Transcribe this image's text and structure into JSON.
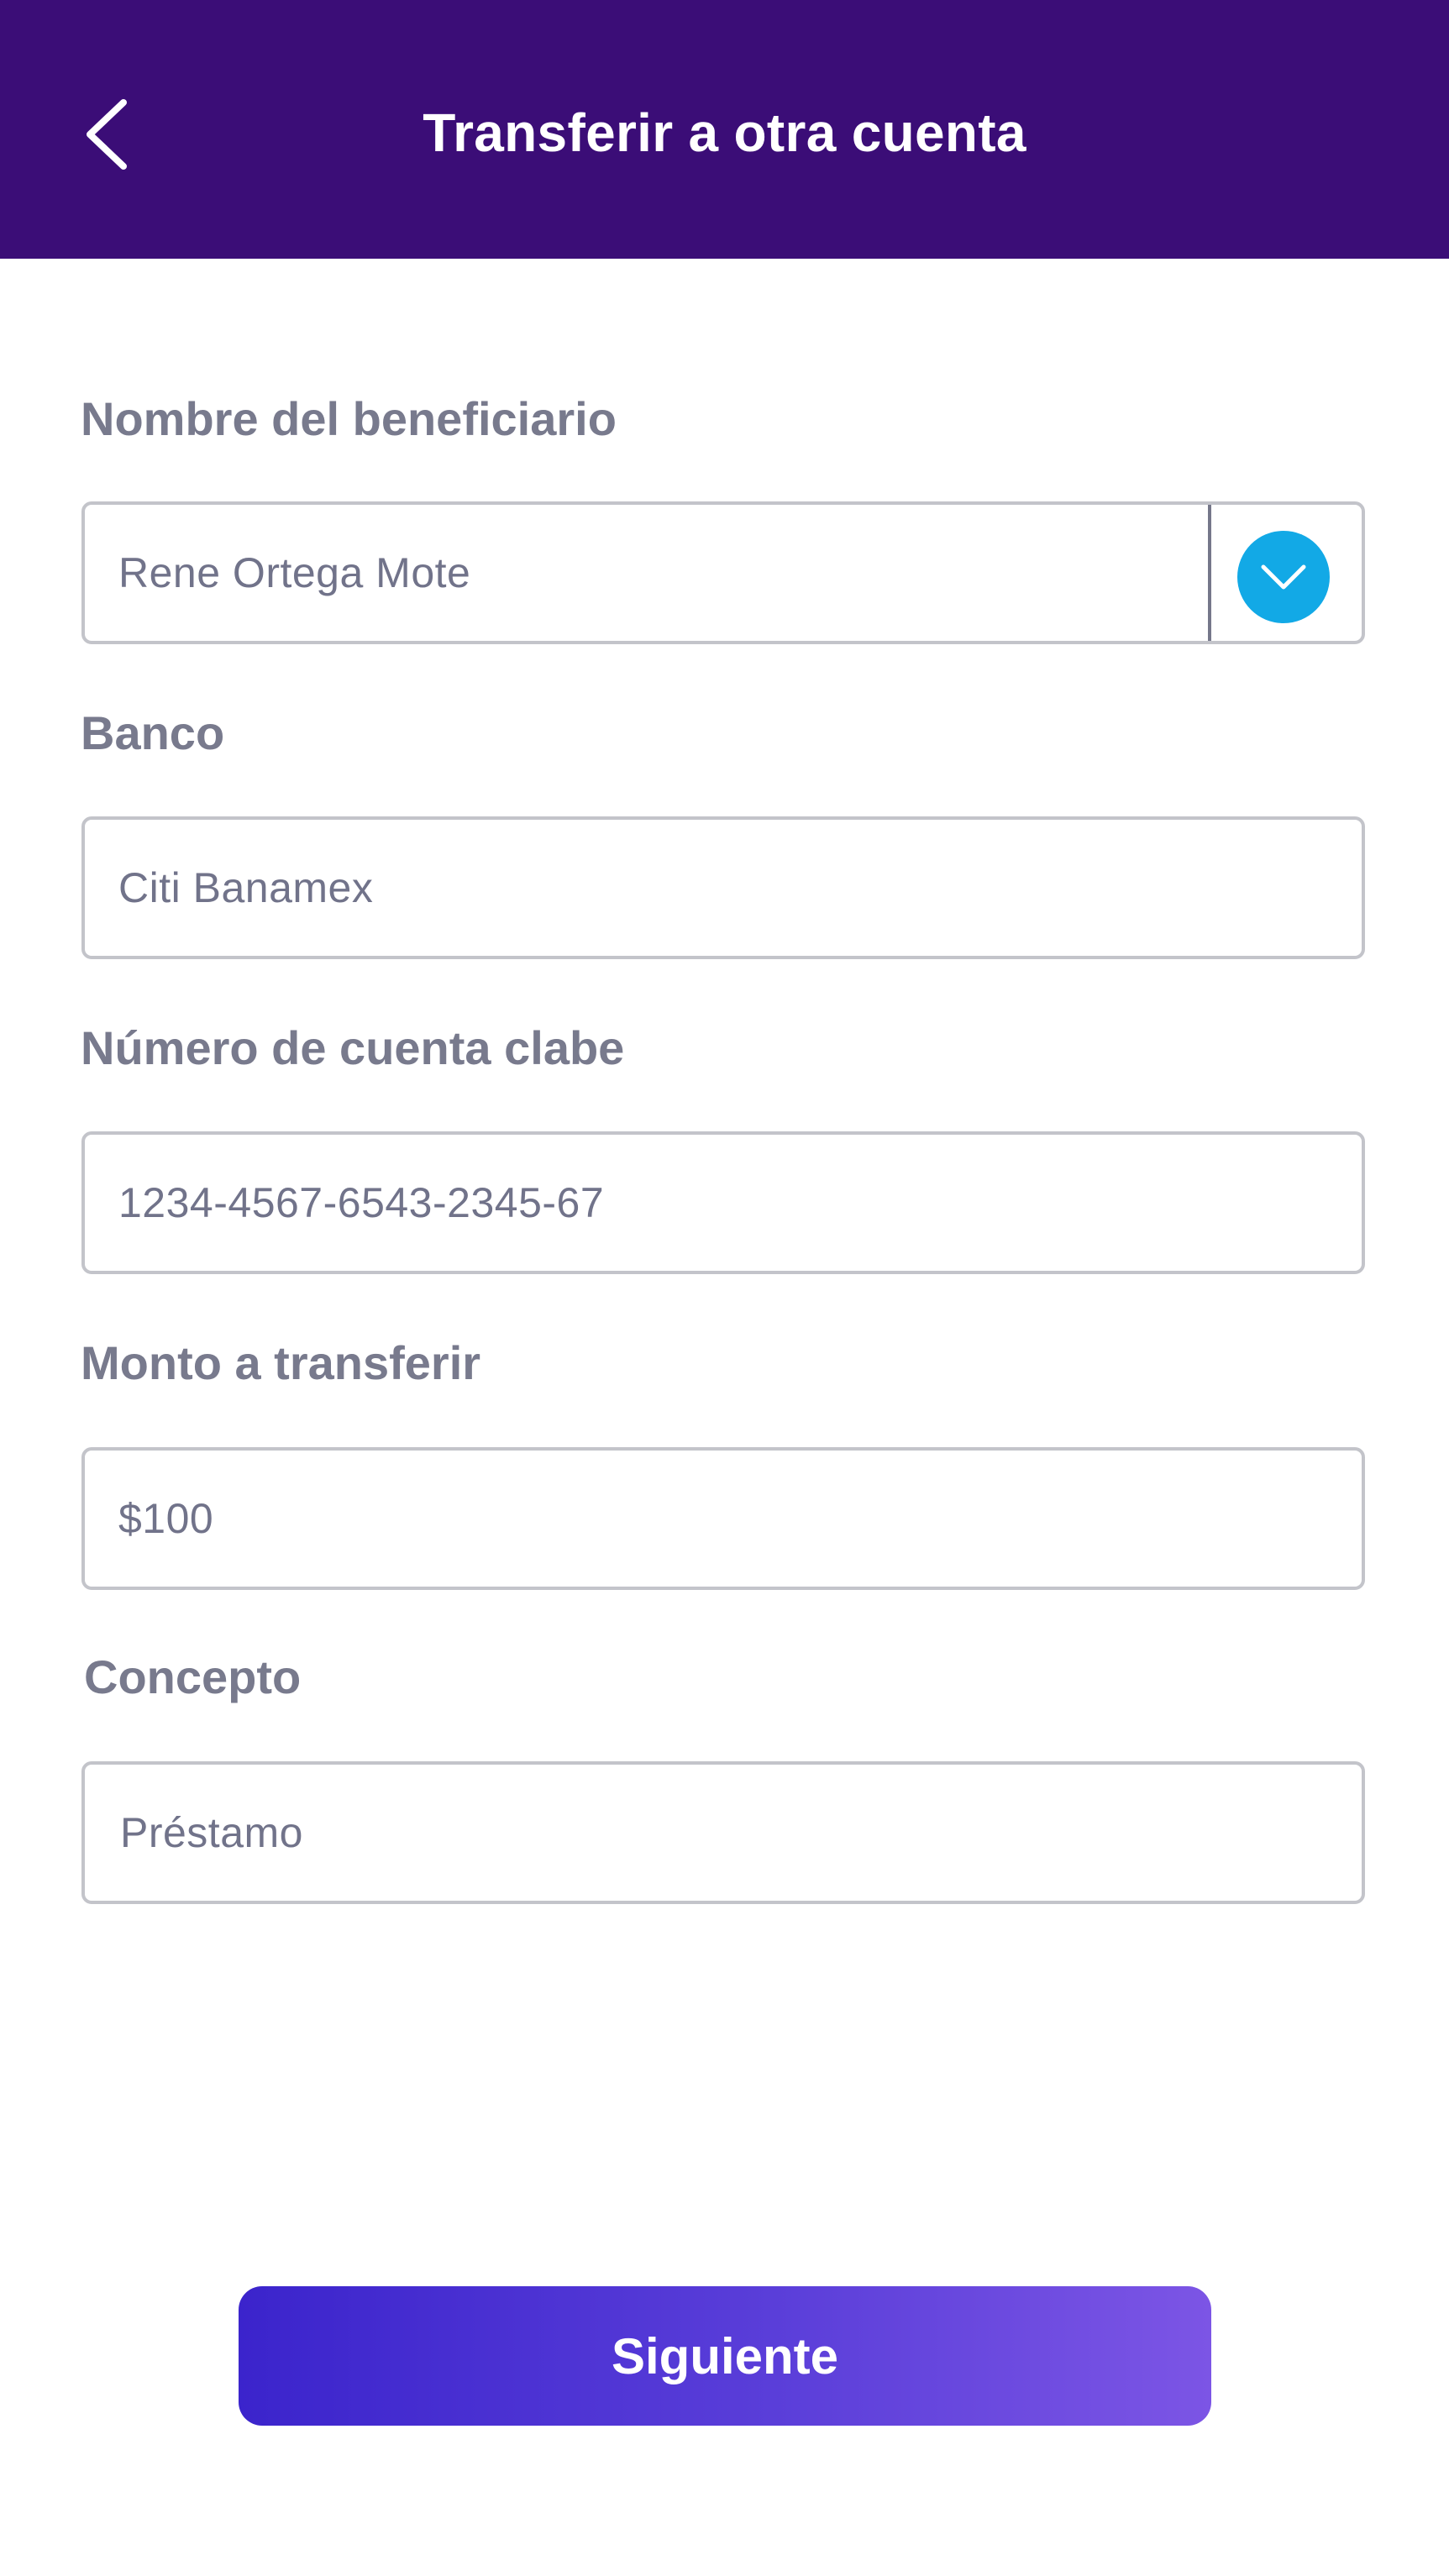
{
  "header": {
    "title": "Transferir a otra cuenta",
    "background_color": "#3b0d77",
    "back_icon": "chevron-left-icon"
  },
  "form": {
    "beneficiary": {
      "label": "Nombre del beneficiario",
      "value": "Rene Ortega Mote",
      "dropdown_icon": "chevron-down-icon",
      "dropdown_color": "#12a9e6"
    },
    "bank": {
      "label": "Banco",
      "value": "Citi Banamex"
    },
    "account": {
      "label": "Número de cuenta clabe",
      "value": "1234-4567-6543-2345-67"
    },
    "amount": {
      "label": "Monto a transferir",
      "value": "$100"
    },
    "concept": {
      "label": "Concepto",
      "value": "Préstamo"
    }
  },
  "actions": {
    "next_label": "Siguiente",
    "gradient_start": "#3b24cc",
    "gradient_end": "#7c55e5"
  }
}
